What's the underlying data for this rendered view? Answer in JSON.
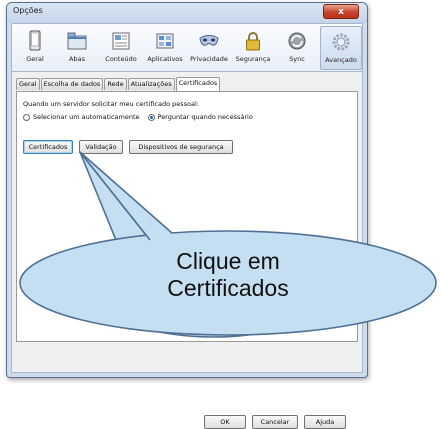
{
  "window": {
    "title": "Opções",
    "close_label": "x"
  },
  "toolbar": {
    "items": [
      {
        "label": "Geral",
        "icon": "device-icon"
      },
      {
        "label": "Abas",
        "icon": "tabs-icon"
      },
      {
        "label": "Conteúdo",
        "icon": "content-icon"
      },
      {
        "label": "Aplicativos",
        "icon": "applications-icon"
      },
      {
        "label": "Privacidade",
        "icon": "mask-icon"
      },
      {
        "label": "Segurança",
        "icon": "lock-icon"
      },
      {
        "label": "Sync",
        "icon": "sync-icon"
      },
      {
        "label": "Avançado",
        "icon": "gear-icon"
      }
    ]
  },
  "tabs": [
    "Geral",
    "Escolha de dados",
    "Rede",
    "Atualizações",
    "Certificados"
  ],
  "certificates": {
    "question": "Quando um servidor solicitar meu certificado pessoal:",
    "option_auto": "Selecionar um automaticamente",
    "option_ask": "Perguntar quando necessário",
    "btn_certificates": "Certificados",
    "btn_validation": "Validação",
    "btn_security_devices": "Dispositivos de segurança"
  },
  "footer": {
    "ok": "OK",
    "cancel": "Cancelar",
    "help": "Ajuda"
  },
  "callout": {
    "line1": "Clique em",
    "line2": "Certificados",
    "fill": "#c5dff2",
    "stroke": "#4f6f94"
  }
}
